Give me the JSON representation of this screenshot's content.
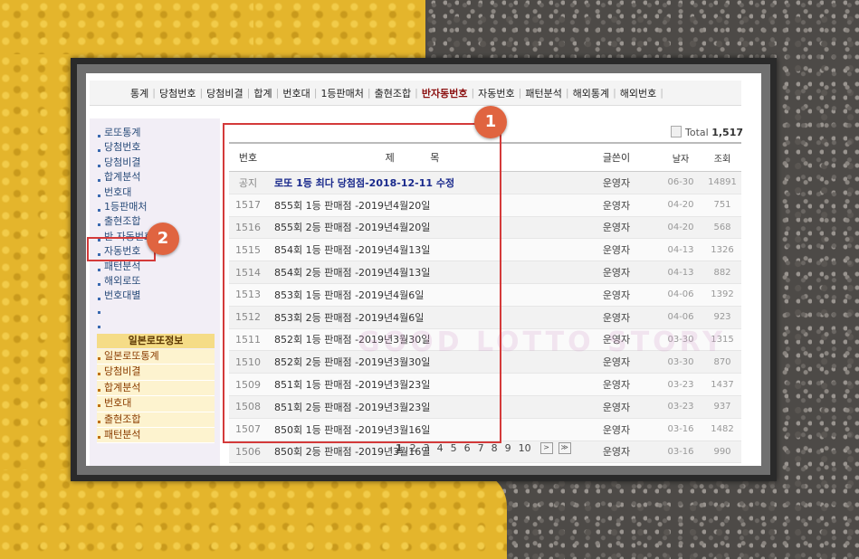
{
  "nav": {
    "items": [
      {
        "label": "통계"
      },
      {
        "label": "당첨번호"
      },
      {
        "label": "당첨비결"
      },
      {
        "label": "합계"
      },
      {
        "label": "번호대"
      },
      {
        "label": "1등판매처"
      },
      {
        "label": "출현조합"
      },
      {
        "label": "반자동번호",
        "active": true
      },
      {
        "label": "자동번호"
      },
      {
        "label": "패턴분석"
      },
      {
        "label": "해외통계"
      },
      {
        "label": "해외번호"
      }
    ]
  },
  "sidebar": {
    "items": [
      {
        "label": "로또통계"
      },
      {
        "label": "당첨번호"
      },
      {
        "label": "당첨비결"
      },
      {
        "label": "합계분석"
      },
      {
        "label": "번호대"
      },
      {
        "label": "1등판매처"
      },
      {
        "label": "출현조합"
      },
      {
        "label": "반 자동번호"
      },
      {
        "label": "자동번호"
      },
      {
        "label": "패턴분석"
      },
      {
        "label": "해외로또"
      },
      {
        "label": "번호대별"
      },
      {
        "label": ""
      },
      {
        "label": ""
      }
    ],
    "jp_header": "일본로또정보",
    "jp_items": [
      {
        "label": "일본로또통계"
      },
      {
        "label": "당첨비결"
      },
      {
        "label": "합계분석"
      },
      {
        "label": "번호대"
      },
      {
        "label": "출현조합"
      },
      {
        "label": "패턴분석"
      }
    ]
  },
  "board": {
    "total_label": "Total",
    "total_count": "1,517",
    "headers": {
      "no": "번호",
      "title": "제 목",
      "author": "글쓴이",
      "date": "날자",
      "views": "조회"
    },
    "rows": [
      {
        "no": "공지",
        "title": "로또 1등 최다 당첨점-2018-12-11 수정",
        "author": "운영자",
        "date": "06-30",
        "views": "14891",
        "notice": true
      },
      {
        "no": "1517",
        "title": "855회 1등 판매점 -2019년4월20일",
        "author": "운영자",
        "date": "04-20",
        "views": "751"
      },
      {
        "no": "1516",
        "title": "855회 2등 판매점 -2019년4월20일",
        "author": "운영자",
        "date": "04-20",
        "views": "568"
      },
      {
        "no": "1515",
        "title": "854회 1등 판매점 -2019년4월13일",
        "author": "운영자",
        "date": "04-13",
        "views": "1326"
      },
      {
        "no": "1514",
        "title": "854회 2등 판매점 -2019년4월13일",
        "author": "운영자",
        "date": "04-13",
        "views": "882"
      },
      {
        "no": "1513",
        "title": "853회 1등 판매점 -2019년4월6일",
        "author": "운영자",
        "date": "04-06",
        "views": "1392"
      },
      {
        "no": "1512",
        "title": "853회 2등 판매점 -2019년4월6일",
        "author": "운영자",
        "date": "04-06",
        "views": "923"
      },
      {
        "no": "1511",
        "title": "852회 1등 판매점 -2019년3월30일",
        "author": "운영자",
        "date": "03-30",
        "views": "1315"
      },
      {
        "no": "1510",
        "title": "852회 2등 판매점 -2019년3월30일",
        "author": "운영자",
        "date": "03-30",
        "views": "870"
      },
      {
        "no": "1509",
        "title": "851회 1등 판매점 -2019년3월23일",
        "author": "운영자",
        "date": "03-23",
        "views": "1437"
      },
      {
        "no": "1508",
        "title": "851회 2등 판매점 -2019년3월23일",
        "author": "운영자",
        "date": "03-23",
        "views": "937"
      },
      {
        "no": "1507",
        "title": "850회 1등 판매점 -2019년3월16일",
        "author": "운영자",
        "date": "03-16",
        "views": "1482"
      },
      {
        "no": "1506",
        "title": "850회 2등 판매점 -2019년3월16일",
        "author": "운영자",
        "date": "03-16",
        "views": "990"
      }
    ]
  },
  "pagination": {
    "pages": [
      "1",
      "2",
      "3",
      "4",
      "5",
      "6",
      "7",
      "8",
      "9",
      "10"
    ],
    "current": "1",
    "next_symbol": ">",
    "last_symbol": "≫"
  },
  "annotations": {
    "badge1": "1",
    "badge2": "2",
    "color": "#e06440",
    "outline_color": "#d43a3a"
  }
}
